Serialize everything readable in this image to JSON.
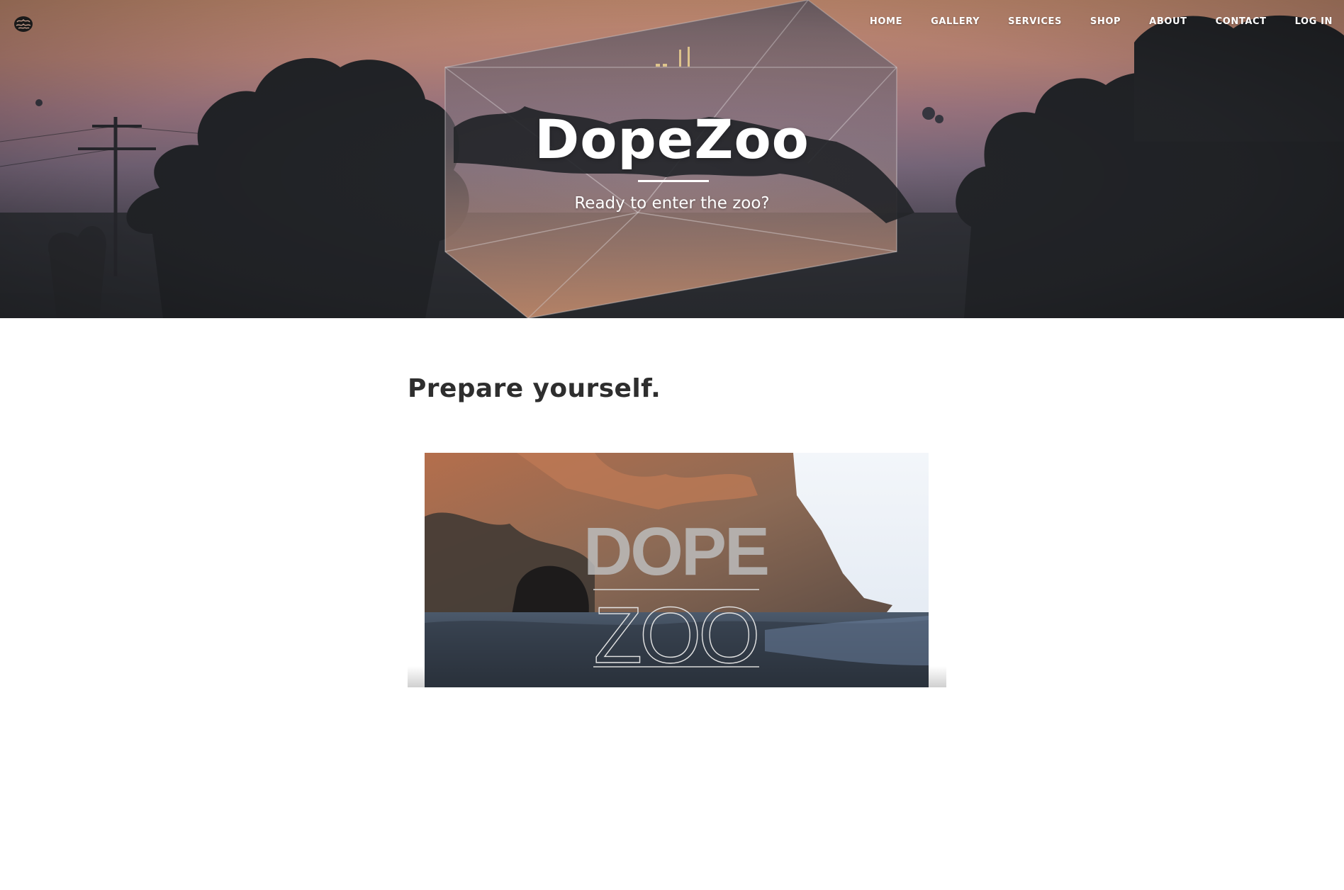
{
  "header": {
    "logo_icon": "brain-icon",
    "nav": [
      {
        "label": "HOME"
      },
      {
        "label": "GALLERY"
      },
      {
        "label": "SERVICES"
      },
      {
        "label": "SHOP"
      },
      {
        "label": "ABOUT"
      },
      {
        "label": "CONTACT"
      },
      {
        "label": "LOG IN"
      }
    ]
  },
  "hero": {
    "title": "DopeZoo",
    "subtitle": "Ready to enter the zoo?"
  },
  "main": {
    "heading": "Prepare yourself.",
    "video": {
      "logo_word_1": "DOPE",
      "logo_word_2": "ZOO"
    }
  },
  "colors": {
    "text_dark": "#2e2e2e",
    "hero_text": "#ffffff",
    "background": "#ffffff"
  }
}
